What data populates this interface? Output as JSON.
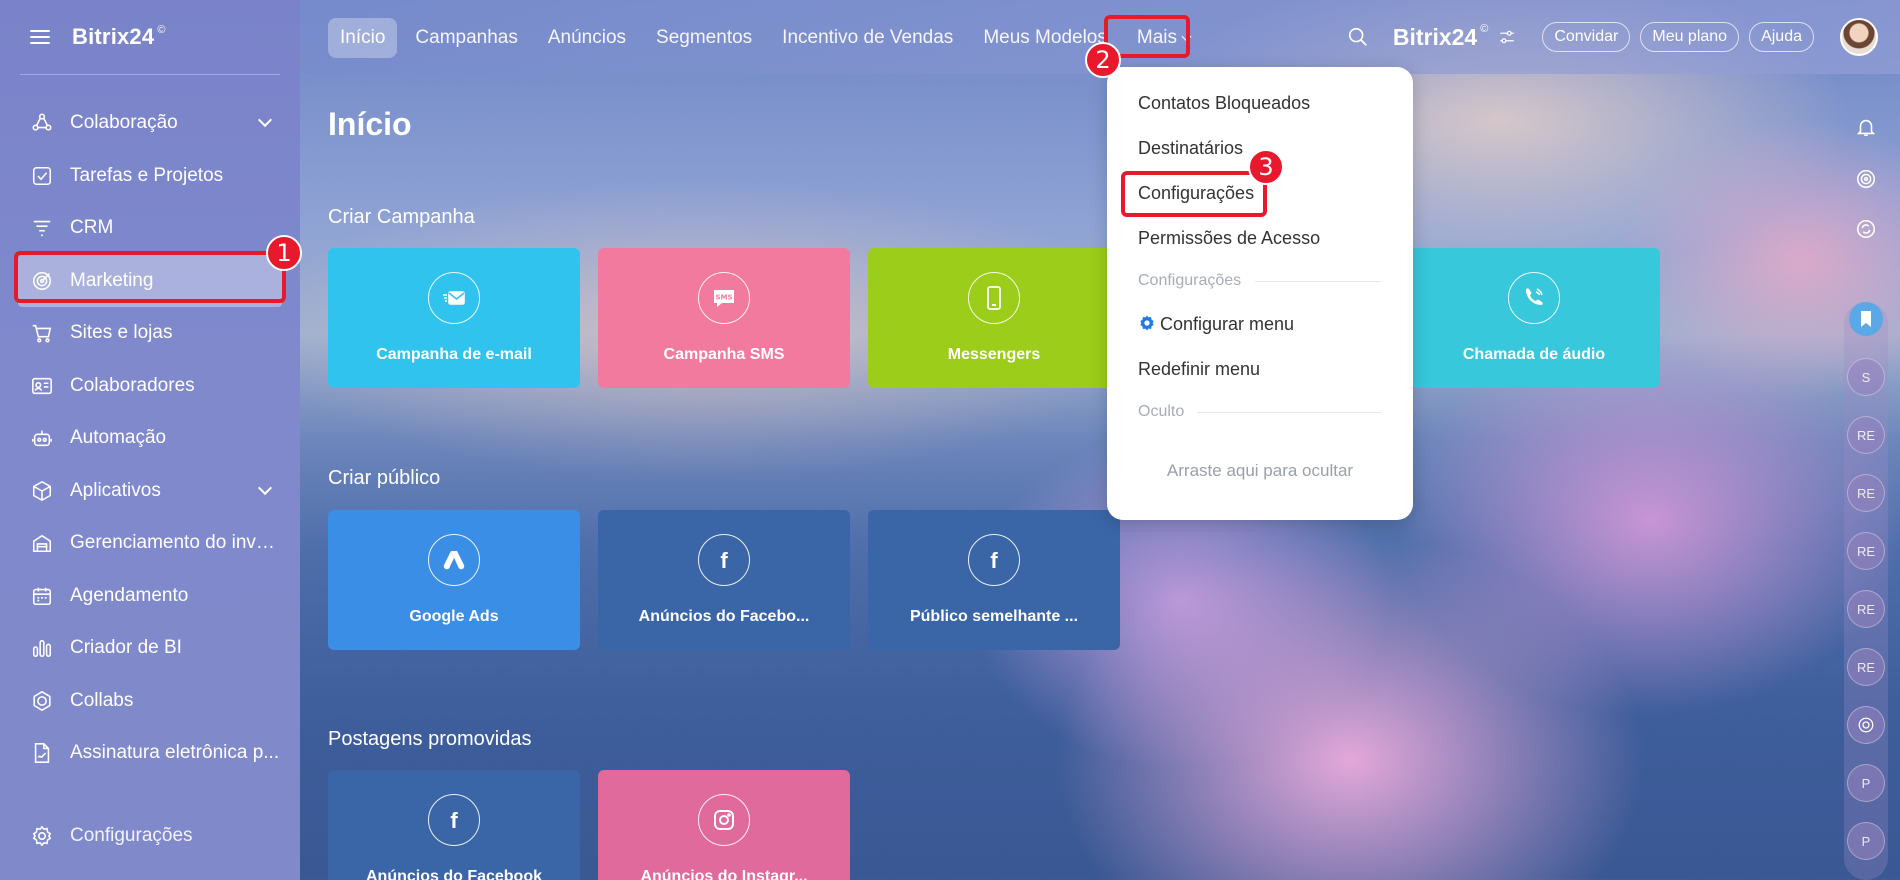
{
  "app": {
    "logo": "Bitrix24",
    "logo_mark": "©"
  },
  "sidebar": {
    "items": [
      {
        "label": "Colaboração",
        "icon": "collaboration-icon",
        "expandable": true
      },
      {
        "label": "Tarefas e Projetos",
        "icon": "tasks-icon"
      },
      {
        "label": "CRM",
        "icon": "crm-icon"
      },
      {
        "label": "Marketing",
        "icon": "marketing-icon",
        "active": true
      },
      {
        "label": "Sites e lojas",
        "icon": "cart-icon"
      },
      {
        "label": "Colaboradores",
        "icon": "employees-icon"
      },
      {
        "label": "Automação",
        "icon": "robot-icon"
      },
      {
        "label": "Aplicativos",
        "icon": "apps-icon",
        "expandable": true
      },
      {
        "label": "Gerenciamento do inve...",
        "icon": "inventory-icon"
      },
      {
        "label": "Agendamento",
        "icon": "calendar-icon"
      },
      {
        "label": "Criador de BI",
        "icon": "bi-chart-icon"
      },
      {
        "label": "Collabs",
        "icon": "collabs-icon"
      },
      {
        "label": "Assinatura eletrônica p...",
        "icon": "esign-icon"
      }
    ],
    "bottom": {
      "label": "Configurações",
      "icon": "gear-icon"
    }
  },
  "topbar": {
    "tabs": [
      "Início",
      "Campanhas",
      "Anúncios",
      "Segmentos",
      "Incentivo de Vendas",
      "Meus Modelos",
      "Mais"
    ],
    "active_tab": "Início",
    "logo": "Bitrix24",
    "buttons": {
      "invite": "Convidar",
      "plan": "Meu plano",
      "help": "Ajuda"
    }
  },
  "main": {
    "title": "Início",
    "sections": [
      {
        "title": "Criar Campanha",
        "tiles": [
          {
            "label": "Campanha de e-mail",
            "icon": "email-campaign-icon",
            "color": "#2fc3ee"
          },
          {
            "label": "Campanha SMS",
            "icon": "sms-icon",
            "color": "#f27a9f"
          },
          {
            "label": "Messengers",
            "icon": "phone-icon",
            "color": "#9ccd1a"
          },
          {
            "label": "Chamada de áudio",
            "icon": "audio-call-icon",
            "color": "#37c8db"
          }
        ]
      },
      {
        "title": "Criar público",
        "tiles": [
          {
            "label": "Google Ads",
            "icon": "google-ads-icon",
            "color": "#3a8ee6"
          },
          {
            "label": "Anúncios do Facebo...",
            "icon": "facebook-icon",
            "color": "#3a66a8"
          },
          {
            "label": "Público semelhante ...",
            "icon": "facebook-icon",
            "color": "#3a66a8"
          }
        ]
      },
      {
        "title": "Postagens promovidas",
        "tiles": [
          {
            "label": "Anúncios do Facebook",
            "icon": "facebook-icon",
            "color": "#3a66a8"
          },
          {
            "label": "Anúncios do Instagr...",
            "icon": "instagram-icon",
            "color": "#e06a9c"
          }
        ]
      }
    ]
  },
  "dropdown": {
    "items": [
      "Contatos Bloqueados",
      "Destinatários",
      "Configurações",
      "Permissões de Acesso"
    ],
    "section_settings": "Configurações",
    "configure_menu": "Configurar menu",
    "reset_menu": "Redefinir menu",
    "section_hidden": "Oculto",
    "drag_hint": "Arraste aqui para ocultar"
  },
  "rail": {
    "avatars": [
      "S",
      "RE",
      "RE",
      "RE",
      "RE",
      "RE",
      "",
      "P",
      "P"
    ]
  },
  "annotations": {
    "badges": [
      "1",
      "2",
      "3"
    ],
    "color": "#e8192c"
  },
  "colors": {
    "accent_blue": "#1e7be6",
    "highlight_red": "#e8192c"
  }
}
